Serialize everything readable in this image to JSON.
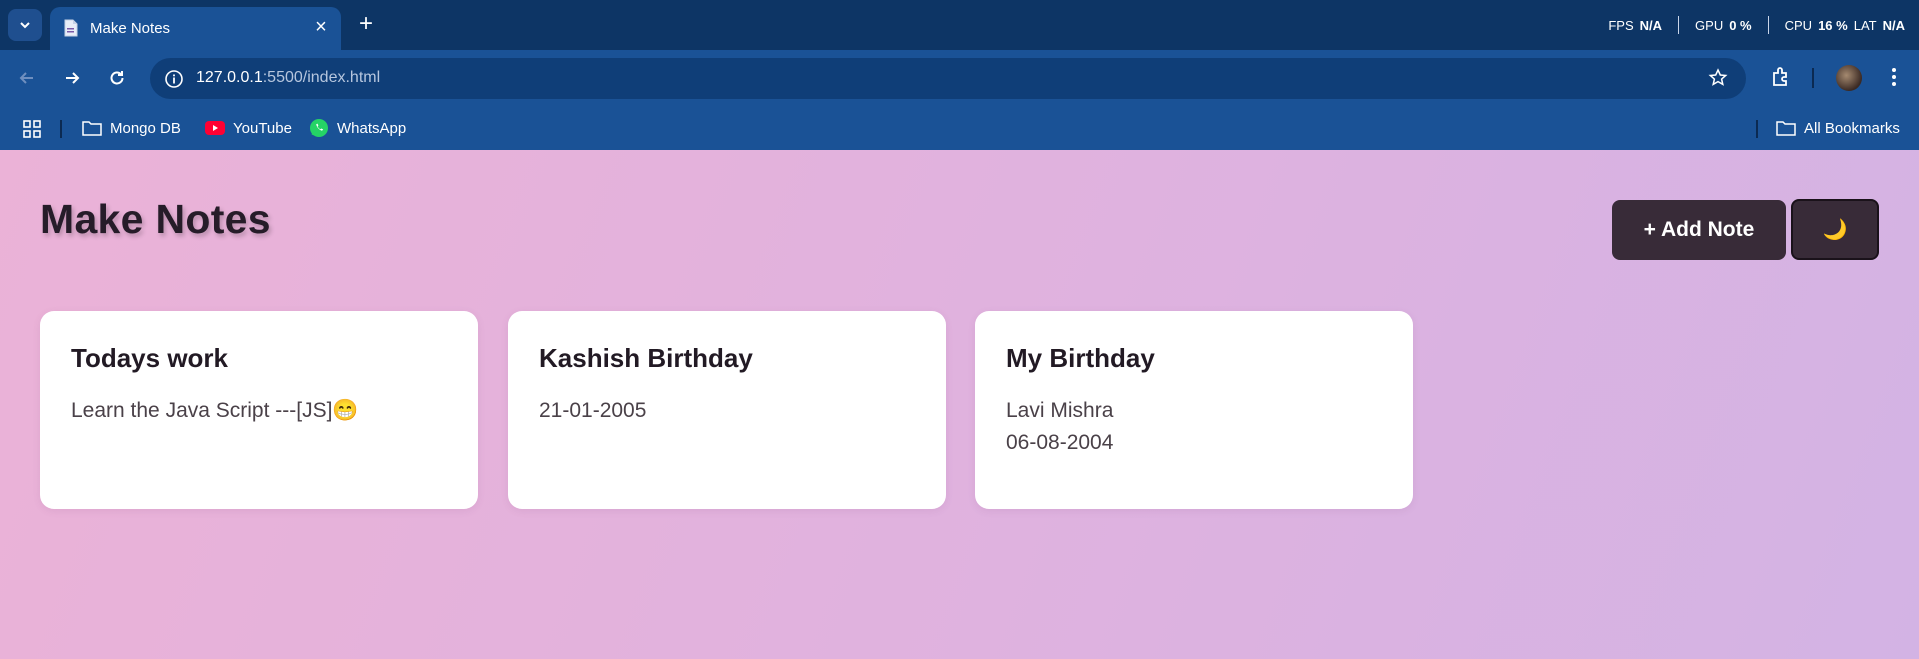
{
  "browser": {
    "tab": {
      "title": "Make Notes"
    },
    "stats": {
      "fps_label": "FPS",
      "fps_value": "N/A",
      "gpu_label": "GPU",
      "gpu_value": "0 %",
      "cpu_label": "CPU",
      "cpu_value": "16 %",
      "lat_label": "LAT",
      "lat_value": "N/A"
    },
    "address": {
      "host": "127.0.0.1",
      "rest": ":5500/index.html"
    },
    "bookmarks": [
      {
        "label": "Mongo DB",
        "icon": "folder-icon"
      },
      {
        "label": "YouTube",
        "icon": "youtube-icon"
      },
      {
        "label": "WhatsApp",
        "icon": "whatsapp-icon"
      }
    ],
    "all_bookmarks": "All Bookmarks"
  },
  "app": {
    "title": "Make Notes",
    "add_button": "+ Add Note",
    "theme_button_icon": "moon-icon",
    "theme_glyph": "🌙",
    "notes": [
      {
        "title": "Todays work",
        "body": "Learn the Java Script ---[JS]😁"
      },
      {
        "title": "Kashish Birthday",
        "body": "21-01-2005"
      },
      {
        "title": "My Birthday",
        "body": "Lavi Mishra\n06-08-2004"
      }
    ]
  },
  "colors": {
    "tabbar": "#0d3565",
    "toolbar": "#1a5296",
    "button_dark": "#382b38",
    "page_gradient_start": "#ebb2d7",
    "page_gradient_end": "#d3b3e4"
  }
}
